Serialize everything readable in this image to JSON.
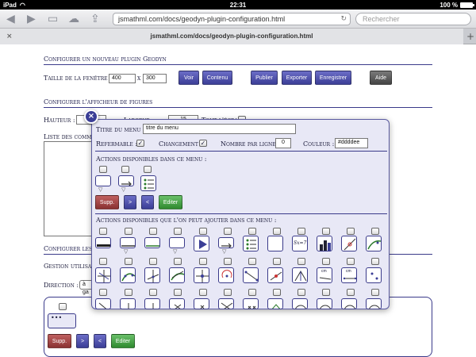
{
  "status": {
    "device": "iPad",
    "time": "22:31",
    "battery": "100 %"
  },
  "browser": {
    "url": "jsmathml.com/docs/geodyn-plugin-configuration.html",
    "search_placeholder": "Rechercher",
    "tab_title": "jsmathml.com/docs/geodyn-plugin-configuration.html",
    "tab_close": "×",
    "tab_add": "+"
  },
  "config": {
    "section1": "Configurer un nouveau plugin Geodyn",
    "window_size_label": "Taille de la fenêtre :",
    "width": "400",
    "x_sep": "x",
    "height": "300",
    "buttons": {
      "voir": "Voir",
      "contenu": "Contenu",
      "publier": "Publier",
      "exporter": "Exporter",
      "enregistrer": "Enregistrer",
      "aide": "Aide"
    },
    "section2": "Configurer l'afficheur de figures",
    "hauteur_label": "Hauteur :",
    "largeur_label": "Largeur :",
    "largeur_value": "15",
    "tout_ecran_label": "Tout l'écran :",
    "liste_label": "Liste des comma",
    "section3": "Configurer les",
    "gestion_label": "Gestion utilisat",
    "direction_label": "Direction :",
    "direction_value": "à ga"
  },
  "bottom_panel": {
    "supp": "Supp.",
    "gt": ">",
    "lt": "<",
    "editer": "Editer"
  },
  "modal": {
    "close": "×",
    "titre_label": "Titre du menu :",
    "titre_value": "titre du menu",
    "refermable_label": "Refermable :",
    "refermable_checked": true,
    "changement_label": "Changement :",
    "changement_checked": true,
    "nombre_label": "Nombre par ligne :",
    "nombre_value": "0",
    "couleur_label": "Couleur :",
    "couleur_value": "#ddddee",
    "actions_dispo_label": "Actions disponibles dans ce menu :",
    "supp": "Supp.",
    "gt": ">",
    "lt": "<",
    "editer": "Editer",
    "actions_ajout_label": "Actions disponibles que l'on peut ajouter dans ce menu :",
    "sx_label": "Sx=7",
    "cm_label": "cm"
  },
  "colors": {
    "accent": "#3b3e96",
    "panel_bg": "#e8e8f6",
    "red": "#8a3232",
    "green": "#2f8a2f"
  }
}
